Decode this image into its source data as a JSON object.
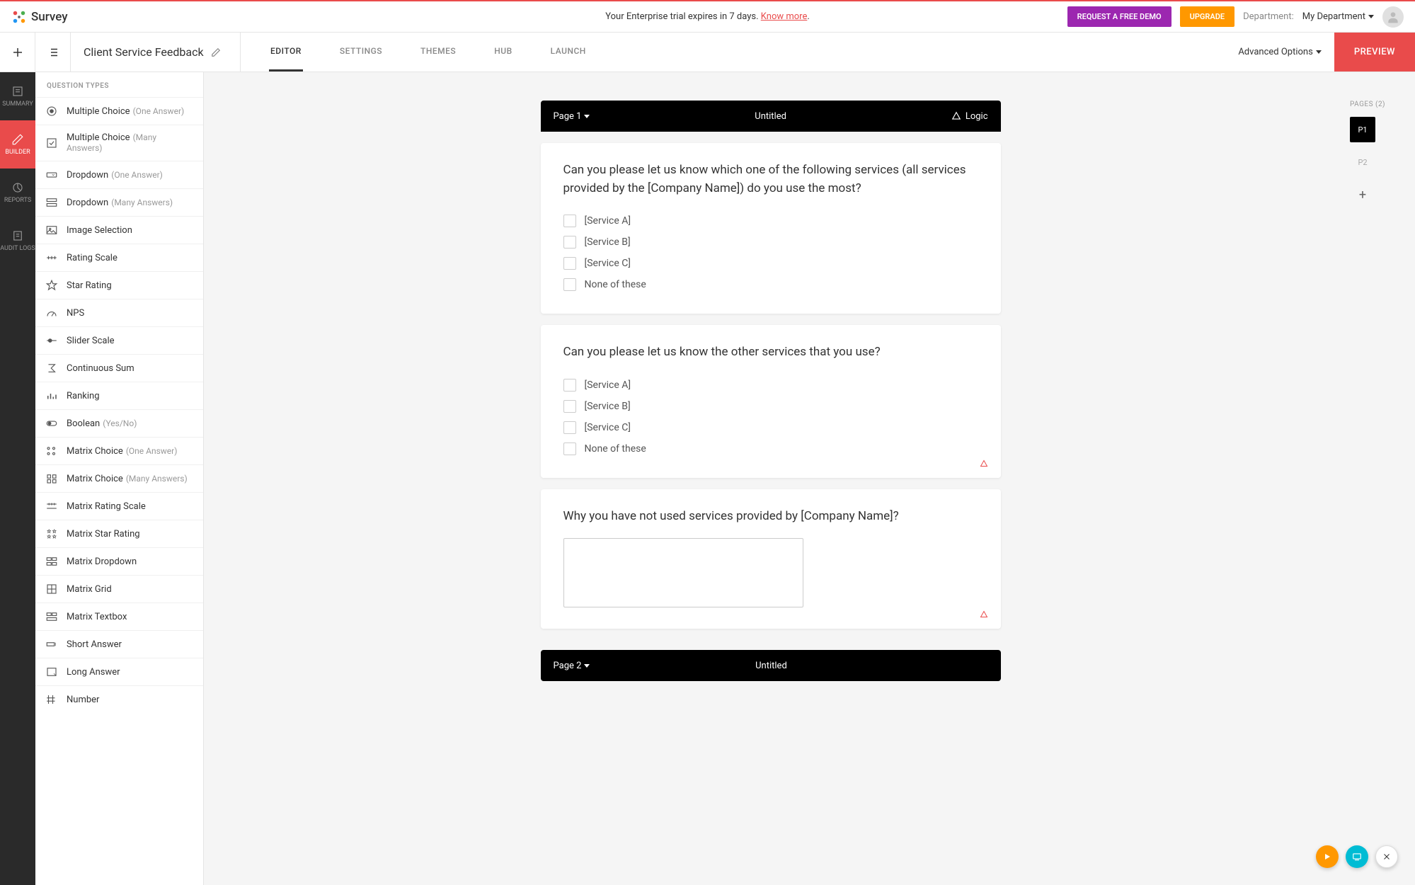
{
  "header": {
    "logo_text": "Survey",
    "trial_prefix": "Your Enterprise trial expires in 7 days. ",
    "trial_link": "Know more",
    "trial_suffix": ".",
    "demo_btn": "REQUEST A FREE DEMO",
    "upgrade_btn": "UPGRADE",
    "dept_label": "Department:",
    "dept_value": "My Department"
  },
  "subheader": {
    "title": "Client Service Feedback",
    "tabs": {
      "editor": "EDITOR",
      "settings": "SETTINGS",
      "themes": "THEMES",
      "hub": "HUB",
      "launch": "LAUNCH"
    },
    "advanced": "Advanced Options",
    "preview": "PREVIEW"
  },
  "rail": {
    "summary": "SUMMARY",
    "builder": "BUILDER",
    "reports": "REPORTS",
    "audit": "AUDIT LOGS"
  },
  "sidebar": {
    "header": "QUESTION TYPES",
    "items": [
      {
        "label": "Multiple Choice",
        "sub": "(One Answer)",
        "icon": "radio"
      },
      {
        "label": "Multiple Choice",
        "sub": "(Many Answers)",
        "icon": "check"
      },
      {
        "label": "Dropdown",
        "sub": "(One Answer)",
        "icon": "dropdown"
      },
      {
        "label": "Dropdown",
        "sub": "(Many Answers)",
        "icon": "dropdown-multi"
      },
      {
        "label": "Image Selection",
        "sub": "",
        "icon": "image"
      },
      {
        "label": "Rating Scale",
        "sub": "",
        "icon": "rating"
      },
      {
        "label": "Star Rating",
        "sub": "",
        "icon": "star"
      },
      {
        "label": "NPS",
        "sub": "",
        "icon": "nps"
      },
      {
        "label": "Slider Scale",
        "sub": "",
        "icon": "slider"
      },
      {
        "label": "Continuous Sum",
        "sub": "",
        "icon": "sum"
      },
      {
        "label": "Ranking",
        "sub": "",
        "icon": "ranking"
      },
      {
        "label": "Boolean",
        "sub": "(Yes/No)",
        "icon": "boolean"
      },
      {
        "label": "Matrix Choice",
        "sub": "(One Answer)",
        "icon": "matrix-r"
      },
      {
        "label": "Matrix Choice",
        "sub": "(Many Answers)",
        "icon": "matrix-c"
      },
      {
        "label": "Matrix Rating Scale",
        "sub": "",
        "icon": "matrix-rating"
      },
      {
        "label": "Matrix Star Rating",
        "sub": "",
        "icon": "matrix-star"
      },
      {
        "label": "Matrix Dropdown",
        "sub": "",
        "icon": "matrix-dd"
      },
      {
        "label": "Matrix Grid",
        "sub": "",
        "icon": "matrix-grid"
      },
      {
        "label": "Matrix Textbox",
        "sub": "",
        "icon": "matrix-tb"
      },
      {
        "label": "Short Answer",
        "sub": "",
        "icon": "short"
      },
      {
        "label": "Long Answer",
        "sub": "",
        "icon": "long"
      },
      {
        "label": "Number",
        "sub": "",
        "icon": "number"
      }
    ]
  },
  "canvas": {
    "page1": {
      "page_label": "Page 1",
      "untitled": "Untitled",
      "logic": "Logic"
    },
    "q1": {
      "text": "Can you please let us know which one of the following services (all services provided by the [Company Name]) do you use the most?",
      "opts": [
        "[Service A]",
        "[Service B]",
        "[Service C]",
        "None of these"
      ]
    },
    "q2": {
      "text": "Can you please let us know the other services that you use?",
      "opts": [
        "[Service A]",
        "[Service B]",
        "[Service C]",
        "None of these"
      ]
    },
    "q3": {
      "text": "Why you have not used services provided by [Company Name]?"
    },
    "page2": {
      "page_label": "Page 2",
      "untitled": "Untitled"
    }
  },
  "pages_panel": {
    "title": "PAGES (2)",
    "p1": "P1",
    "p2": "P2"
  }
}
